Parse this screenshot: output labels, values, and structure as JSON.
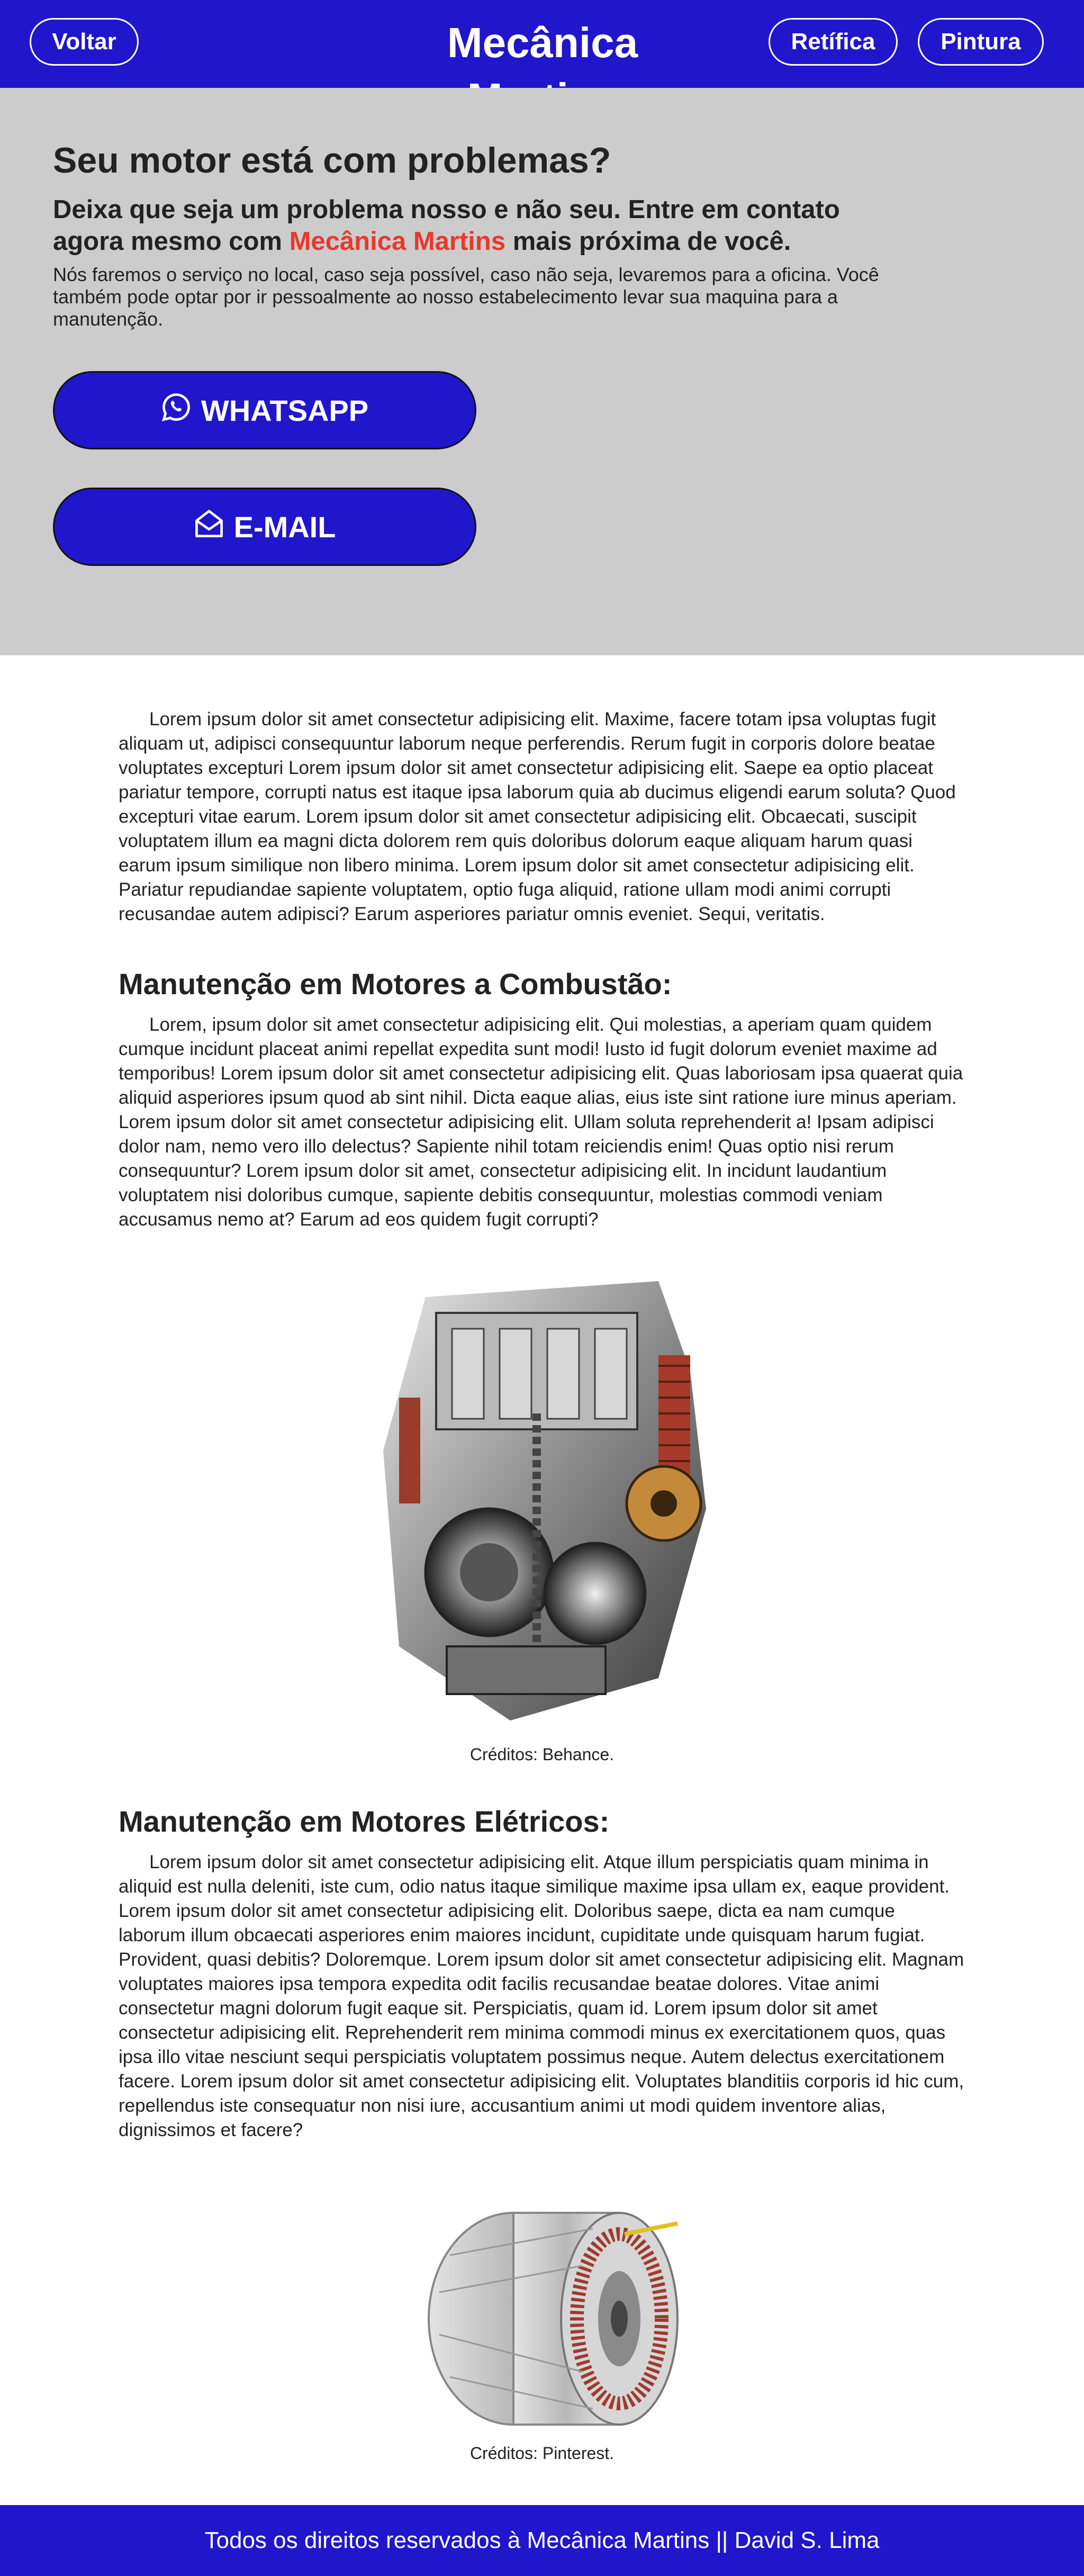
{
  "header": {
    "back_label": "Voltar",
    "brand": "Mecânica Martins",
    "nav": [
      "Retífica",
      "Pintura"
    ]
  },
  "hero": {
    "title": "Seu motor está com problemas?",
    "subtitle_part1": "Deixa que seja um problema nosso e não seu. Entre em contato agora mesmo com ",
    "subtitle_brand": "Mecânica Martins",
    "subtitle_part2": " mais próxima de você.",
    "description": "Nós faremos o serviço no local, caso seja possível, caso não seja, levaremos para a oficina. Você também pode optar por ir pessoalmente ao nosso estabelecimento levar sua maquina para a manutenção.",
    "whatsapp_label": "WHATSAPP",
    "email_label": "E-MAIL"
  },
  "intro": "Lorem ipsum dolor sit amet consectetur adipisicing elit. Maxime, facere totam ipsa voluptas fugit aliquam ut, adipisci consequuntur laborum neque perferendis. Rerum fugit in corporis dolore beatae voluptates excepturi Lorem ipsum dolor sit amet consectetur adipisicing elit. Saepe ea optio placeat pariatur tempore, corrupti natus est itaque ipsa laborum quia ab ducimus eligendi earum soluta? Quod excepturi vitae earum. Lorem ipsum dolor sit amet consectetur adipisicing elit. Obcaecati, suscipit voluptatem illum ea magni dicta dolorem rem quis doloribus dolorum eaque aliquam harum quasi earum ipsum similique non libero minima. Lorem ipsum dolor sit amet consectetur adipisicing elit. Pariatur repudiandae sapiente voluptatem, optio fuga aliquid, ratione ullam modi animi corrupti recusandae autem adipisci? Earum asperiores pariatur omnis eveniet. Sequi, veritatis.",
  "combustion": {
    "title": "Manutenção em Motores a Combustão:",
    "text": "Lorem, ipsum dolor sit amet consectetur adipisicing elit. Qui molestias, a aperiam quam quidem cumque incidunt placeat animi repellat expedita sunt modi! Iusto id fugit dolorum eveniet maxime ad temporibus! Lorem ipsum dolor sit amet consectetur adipisicing elit. Quas laboriosam ipsa quaerat quia aliquid asperiores ipsum quod ab sint nihil. Dicta eaque alias, eius iste sint ratione iure minus aperiam. Lorem ipsum dolor sit amet consectetur adipisicing elit. Ullam soluta reprehenderit a! Ipsam adipisci dolor nam, nemo vero illo delectus? Sapiente nihil totam reiciendis enim! Quas optio nisi rerum consequuntur? Lorem ipsum dolor sit amet, consectetur adipisicing elit. In incidunt laudantium voluptatem nisi doloribus cumque, sapiente debitis consequuntur, molestias commodi veniam accusamus nemo at? Earum ad eos quidem fugit corrupti?",
    "caption": "Créditos: Behance."
  },
  "electric": {
    "title": "Manutenção em Motores Elétricos:",
    "text": "Lorem ipsum dolor sit amet consectetur adipisicing elit. Atque illum perspiciatis quam minima in aliquid est nulla deleniti, iste cum, odio natus itaque similique maxime ipsa ullam ex, eaque provident. Lorem ipsum dolor sit amet consectetur adipisicing elit. Doloribus saepe, dicta ea nam cumque laborum illum obcaecati asperiores enim maiores incidunt, cupiditate unde quisquam harum fugiat. Provident, quasi debitis? Doloremque. Lorem ipsum dolor sit amet consectetur adipisicing elit. Magnam voluptates maiores ipsa tempora expedita odit facilis recusandae beatae dolores. Vitae animi consectetur magni dolorum fugit eaque sit. Perspiciatis, quam id. Lorem ipsum dolor sit amet consectetur adipisicing elit. Reprehenderit rem minima commodi minus ex exercitationem quos, quas ipsa illo vitae nesciunt sequi perspiciatis voluptatem possimus neque. Autem delectus exercitationem facere. Lorem ipsum dolor sit amet consectetur adipisicing elit. Voluptates blanditiis corporis id hic cum, repellendus iste consequatur non nisi iure, accusantium animi ut modi quidem inventore alias, dignissimos et facere?",
    "caption": "Créditos: Pinterest."
  },
  "footer": "Todos os direitos reservados à Mecânica Martins || David S. Lima",
  "colors": {
    "primary": "#2016cc",
    "accent": "#e8382c",
    "hero_bg": "#cccccc"
  },
  "icons": {
    "whatsapp": "whatsapp-icon",
    "email": "envelope-open-icon"
  }
}
